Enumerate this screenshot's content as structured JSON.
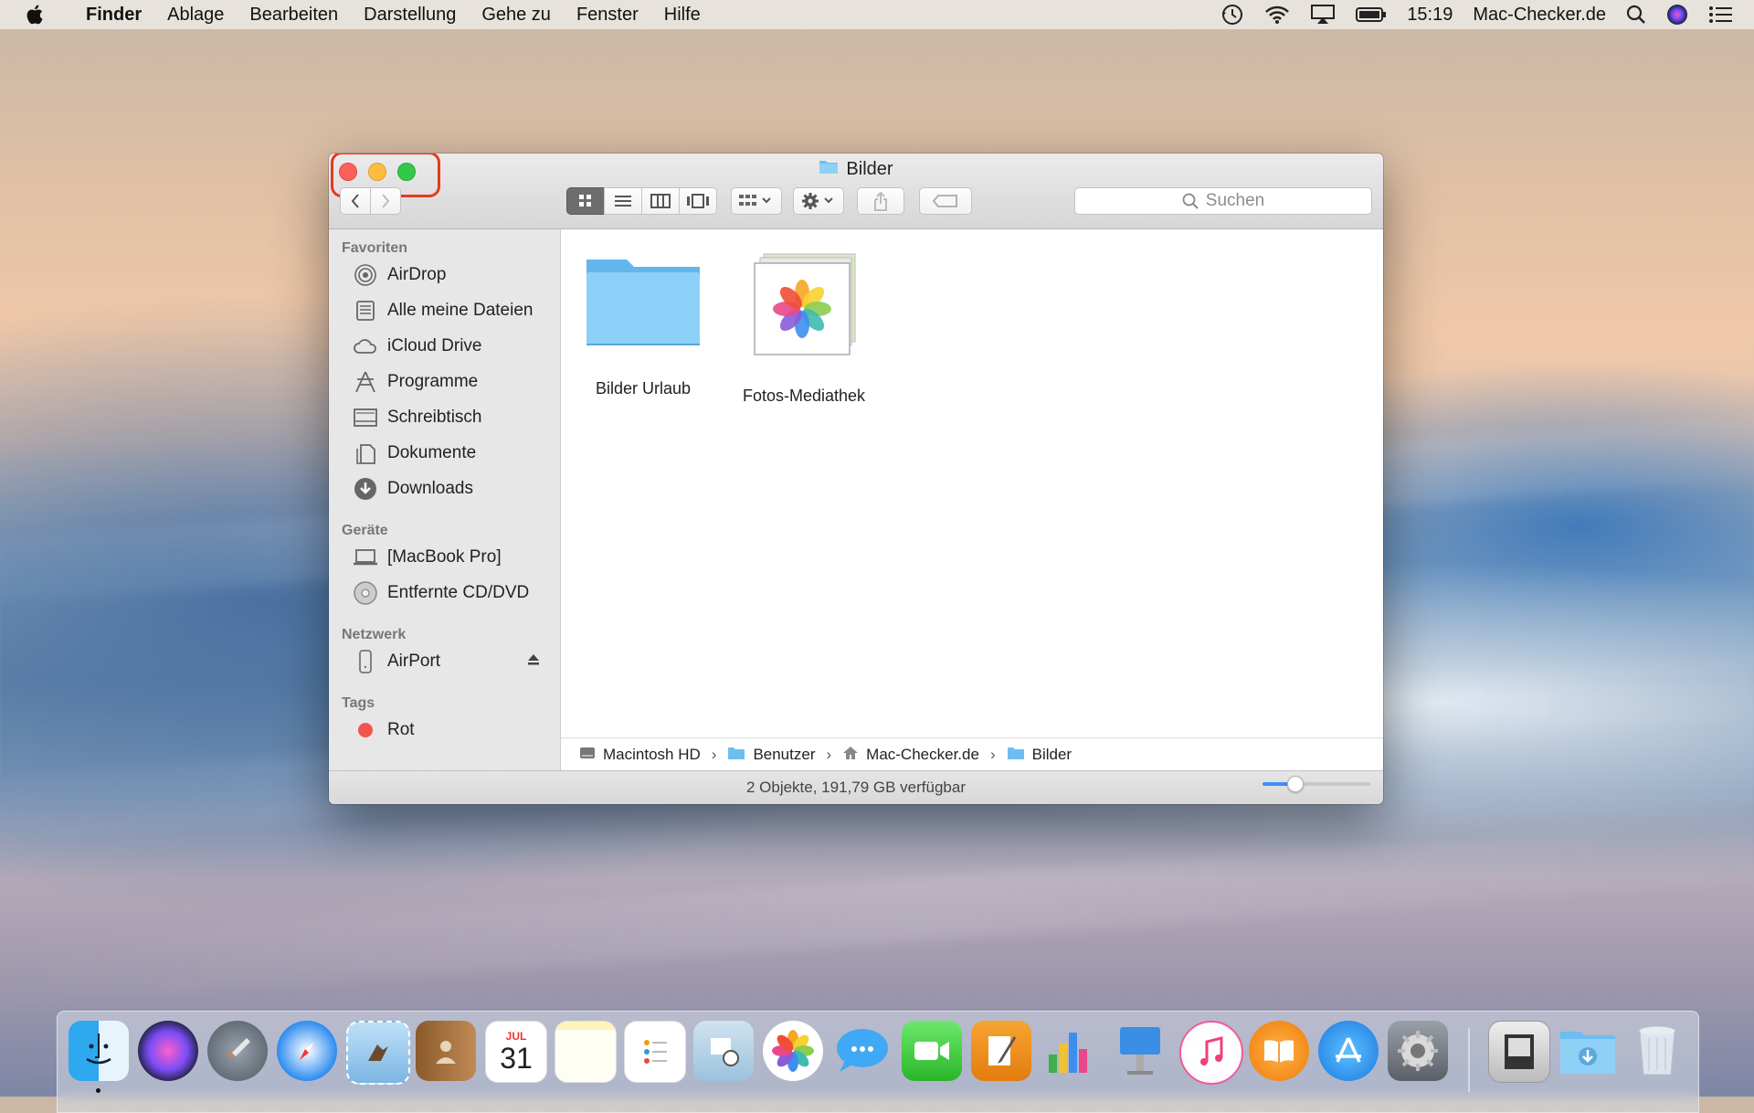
{
  "menubar": {
    "app_name": "Finder",
    "menus": [
      "Ablage",
      "Bearbeiten",
      "Darstellung",
      "Gehe zu",
      "Fenster",
      "Hilfe"
    ],
    "time": "15:19",
    "user": "Mac-Checker.de"
  },
  "window": {
    "title": "Bilder",
    "search_placeholder": "Suchen",
    "sidebar": {
      "sections": [
        {
          "title": "Favoriten",
          "items": [
            "AirDrop",
            "Alle meine Dateien",
            "iCloud Drive",
            "Programme",
            "Schreibtisch",
            "Dokumente",
            "Downloads"
          ]
        },
        {
          "title": "Geräte",
          "items": [
            "[MacBook Pro]",
            "Entfernte CD/DVD"
          ]
        },
        {
          "title": "Netzwerk",
          "items": [
            "AirPort"
          ]
        },
        {
          "title": "Tags",
          "items": [
            "Rot"
          ]
        }
      ]
    },
    "files": [
      {
        "name": "Bilder Urlaub",
        "kind": "folder"
      },
      {
        "name": "Fotos-Mediathek",
        "kind": "photos-library"
      }
    ],
    "pathbar": [
      "Macintosh HD",
      "Benutzer",
      "Mac-Checker.de",
      "Bilder"
    ],
    "status": "2 Objekte, 191,79 GB verfügbar",
    "icon_size_slider": 0.3
  },
  "dock": {
    "apps": [
      "finder",
      "siri",
      "launchpad",
      "safari",
      "mail",
      "contacts",
      "calendar",
      "notes",
      "reminders",
      "preview",
      "photos",
      "messages",
      "facetime",
      "pages",
      "numbers",
      "keynote",
      "itunes",
      "ibooks",
      "app-store",
      "system-preferences",
      "image-capture",
      "downloads",
      "trash"
    ],
    "calendar_month": "JUL",
    "calendar_day": "31"
  },
  "colors": {
    "accent": "#3f8df8",
    "close": "#fc605b",
    "minimize": "#fdbc40",
    "maximize": "#34c84a",
    "highlight": "#e6391d",
    "folder": "#6cbef0"
  }
}
